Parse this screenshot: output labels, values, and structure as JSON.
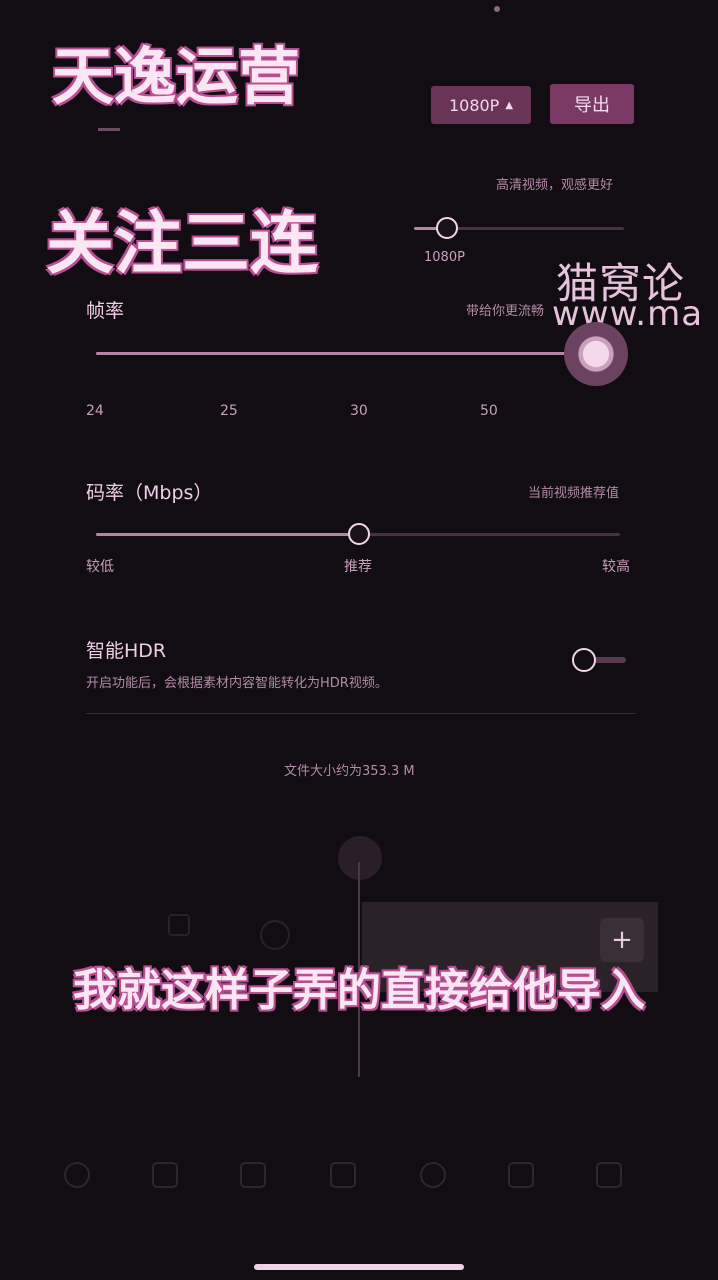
{
  "watermark": {
    "line1": "天逸运营",
    "line2": "关注三连",
    "site_cn": "猫窝论",
    "site_url": "www.ma"
  },
  "header": {
    "resolution_button": "1080P",
    "export_button": "导出"
  },
  "resolution": {
    "hint": "高清视频，观感更好",
    "value_label": "1080P"
  },
  "frame_rate": {
    "label": "帧率",
    "hint": "带给你更流畅",
    "ticks": [
      "24",
      "25",
      "30",
      "50"
    ],
    "position": 0.97
  },
  "bitrate": {
    "label": "码率（Mbps）",
    "hint": "当前视频推荐值",
    "ticks": [
      "较低",
      "推荐",
      "较高"
    ],
    "position": 0.5
  },
  "hdr": {
    "label": "智能HDR",
    "description": "开启功能后，会根据素材内容智能转化为HDR视频。",
    "enabled": false
  },
  "file_size": "文件大小约为353.3 M",
  "subtitle": "我就这样子弄的直接给他导入",
  "colors": {
    "accent": "#b74e92",
    "background": "#120d12"
  }
}
